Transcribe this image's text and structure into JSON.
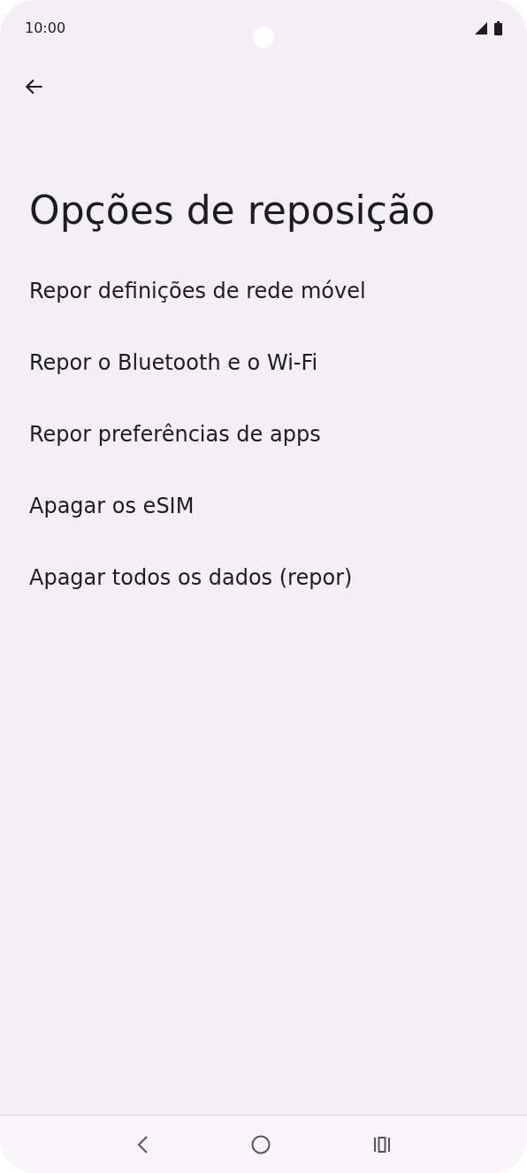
{
  "status_bar": {
    "time": "10:00"
  },
  "title": "Opções de reposição",
  "items": [
    {
      "label": "Repor definições de rede móvel"
    },
    {
      "label": "Repor o Bluetooth e o Wi-Fi"
    },
    {
      "label": "Repor preferências de apps"
    },
    {
      "label": "Apagar os eSIM"
    },
    {
      "label": "Apagar todos os dados (repor)"
    }
  ]
}
